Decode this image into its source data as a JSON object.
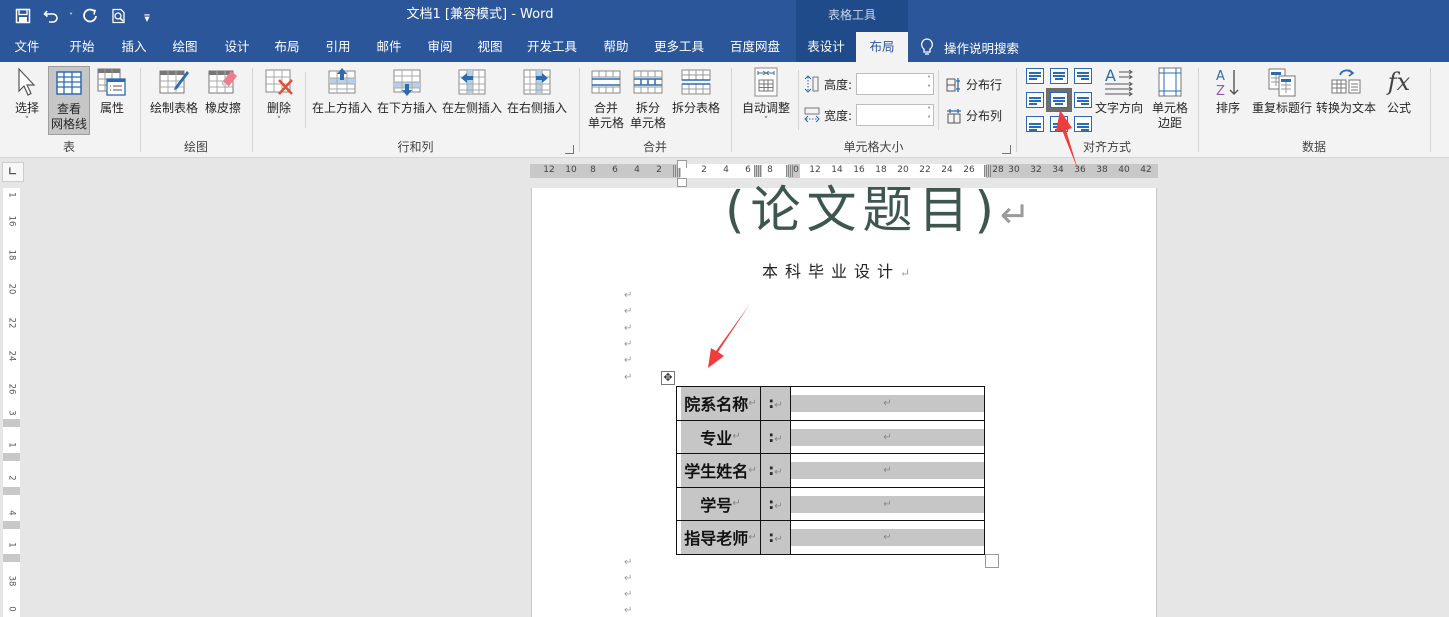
{
  "window": {
    "title": "文档1 [兼容模式]  -  Word",
    "context_title": "表格工具"
  },
  "quick_access": {
    "icons": [
      "save-icon",
      "undo-icon",
      "undo-dropdown-icon",
      "redo-icon",
      "print-preview-icon",
      "customize-qat-icon"
    ]
  },
  "tabs": [
    {
      "label": "文件"
    },
    {
      "label": "开始"
    },
    {
      "label": "插入"
    },
    {
      "label": "绘图"
    },
    {
      "label": "设计"
    },
    {
      "label": "布局"
    },
    {
      "label": "引用"
    },
    {
      "label": "邮件"
    },
    {
      "label": "审阅"
    },
    {
      "label": "视图"
    },
    {
      "label": "开发工具"
    },
    {
      "label": "帮助"
    },
    {
      "label": "更多工具"
    },
    {
      "label": "百度网盘"
    },
    {
      "label": "表设计"
    },
    {
      "label": "布局",
      "active": true
    }
  ],
  "tell_me": {
    "icon": "lightbulb-icon",
    "label": "操作说明搜索"
  },
  "ribbon": {
    "groups": {
      "table": {
        "label": "表",
        "select": "选择",
        "view_gridlines_1": "查看",
        "view_gridlines_2": "网格线",
        "properties": "属性"
      },
      "draw": {
        "label": "绘图",
        "draw_table": "绘制表格",
        "eraser": "橡皮擦"
      },
      "rows_cols": {
        "label": "行和列",
        "delete": "删除",
        "insert_above": "在上方插入",
        "insert_below": "在下方插入",
        "insert_left": "在左侧插入",
        "insert_right": "在右侧插入"
      },
      "merge": {
        "label": "合并",
        "merge_cells_1": "合并",
        "merge_cells_2": "单元格",
        "split_cells_1": "拆分",
        "split_cells_2": "单元格",
        "split_table": "拆分表格"
      },
      "cell_size": {
        "label": "单元格大小",
        "autofit": "自动调整",
        "height_label": "高度:",
        "height_value": "",
        "width_label": "宽度:",
        "width_value": "",
        "distribute_rows": "分布行",
        "distribute_cols": "分布列"
      },
      "alignment": {
        "label": "对齐方式",
        "selected": "align-center-center",
        "text_direction": "文字方向",
        "cell_margins_1": "单元格",
        "cell_margins_2": "边距"
      },
      "data": {
        "label": "数据",
        "sort": "排序",
        "repeat_header": "重复标题行",
        "convert_to_text": "转换为文本",
        "formula": "公式"
      }
    }
  },
  "ruler": {
    "horizontal_ticks_left": [
      "12",
      "10",
      "8",
      "6",
      "4",
      "2"
    ],
    "horizontal_ticks_c1": [
      "2",
      "4",
      "6"
    ],
    "horizontal_ticks_c2": [
      "8"
    ],
    "horizontal_ticks_c3": [
      "0",
      "12",
      "14",
      "16",
      "18",
      "20",
      "22",
      "24",
      "26"
    ],
    "horizontal_ticks_right": [
      "28",
      "30",
      "32",
      "34",
      "36",
      "38",
      "40",
      "42"
    ],
    "vertical_ticks": [
      "1",
      "16",
      "18",
      "20",
      "22",
      "24",
      "26",
      "3",
      "1",
      "2",
      "4",
      "1",
      "38",
      "0"
    ]
  },
  "document": {
    "title": "(论文题目)",
    "subtitle": "本科毕业设计",
    "paragraph_mark": "↵",
    "table": {
      "rows": [
        {
          "label": "院系名称",
          "colon": ":",
          "value": ""
        },
        {
          "label": "专业",
          "colon": ":",
          "value": ""
        },
        {
          "label": "学生姓名",
          "colon": ":",
          "value": ""
        },
        {
          "label": "学号",
          "colon": ":",
          "value": ""
        },
        {
          "label": "指导老师",
          "colon": ":",
          "value": ""
        }
      ]
    }
  },
  "annotations": {
    "arrow_color": "#f03c3c"
  },
  "colors": {
    "brand": "#2b579a",
    "context_tab": "#1f4b8a",
    "title_text": "#3d5650",
    "cell_shading": "#c6c6c6"
  }
}
